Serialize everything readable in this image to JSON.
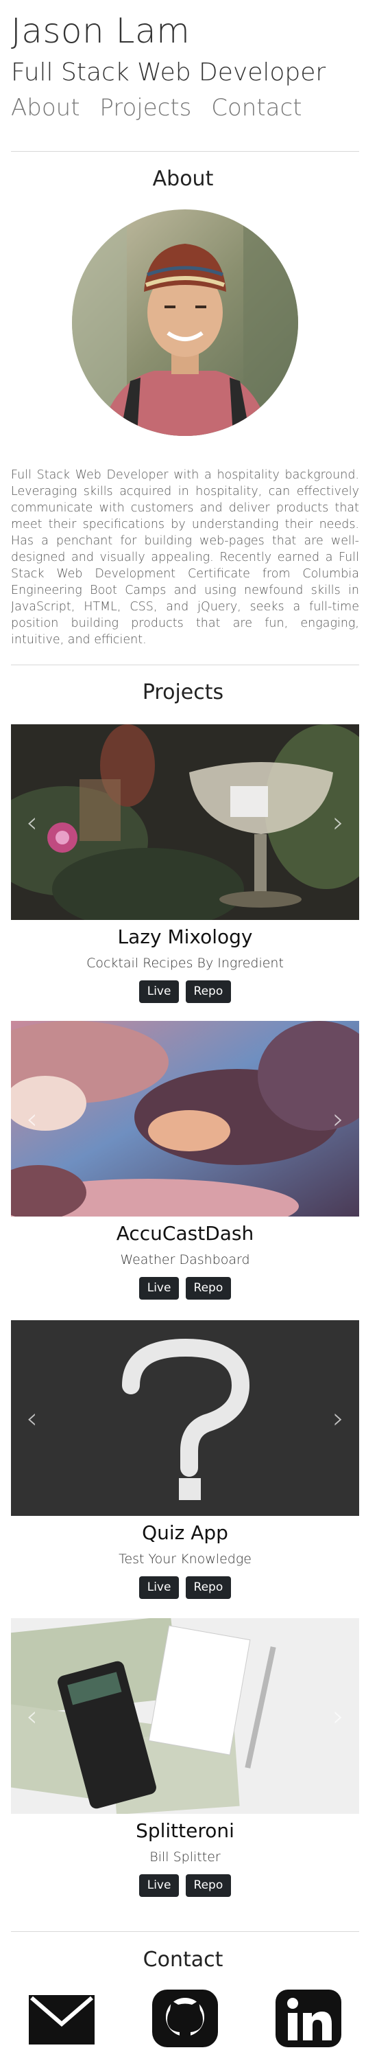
{
  "header": {
    "name": "Jason Lam",
    "role": "Full Stack Web Developer",
    "nav": [
      "About",
      "Projects",
      "Contact"
    ]
  },
  "about": {
    "title": "About",
    "avatar_icon": "avatar-photo",
    "text": "Full Stack Web Developer with a hospitality background. Leveraging skills acquired in hospitality, can effectively communicate with customers and deliver products that meet their specifications by understanding their needs. Has a penchant for building web-pages that are well-designed and visually appealing. Recently earned a Full Stack Web Development Certificate from Columbia Engineering Boot Camps and using newfound skills in JavaScript, HTML, CSS, and jQuery, seeks a full-time position building products that are fun, engaging, intuitive, and efficient."
  },
  "projects": {
    "title": "Projects",
    "items": [
      {
        "title": "Lazy Mixology",
        "subtitle": "Cocktail Recipes By Ingredient",
        "live": "Live",
        "repo": "Repo"
      },
      {
        "title": "AccuCastDash",
        "subtitle": "Weather Dashboard",
        "live": "Live",
        "repo": "Repo"
      },
      {
        "title": "Quiz App",
        "subtitle": "Test Your Knowledge",
        "live": "Live",
        "repo": "Repo"
      },
      {
        "title": "Splitteroni",
        "subtitle": "Bill Splitter",
        "live": "Live",
        "repo": "Repo"
      }
    ],
    "prev_icon": "chevron-left-icon",
    "next_icon": "chevron-right-icon"
  },
  "contact": {
    "title": "Contact",
    "icons": [
      "envelope-icon",
      "github-icon",
      "linkedin-icon"
    ]
  },
  "colors": {
    "button_bg": "#212529",
    "divider": "#d8d8d8"
  }
}
